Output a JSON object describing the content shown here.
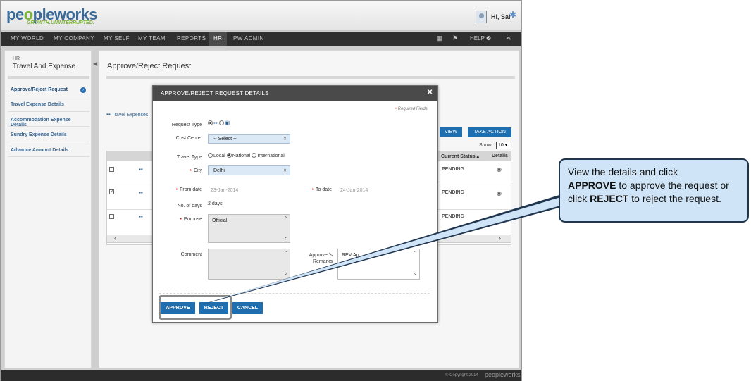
{
  "app": {
    "logo_pre": "pe",
    "logo_o": "o",
    "logo_post": "pleworks",
    "tagline": "GROWTH.UNINTERRUPTED.",
    "greeting": "Hi, Sai",
    "settings_icon": "gear-icon"
  },
  "nav": {
    "items": [
      "MY WORLD",
      "MY COMPANY",
      "MY SELF",
      "MY TEAM",
      "REPORTS",
      "HR",
      "PW ADMIN"
    ],
    "active": "HR",
    "help": "HELP ❷"
  },
  "sidebar": {
    "small": "HR",
    "title": "Travel And Expense",
    "items": [
      "Approve/Reject Request",
      "Travel Expense Details",
      "Accommodation Expense Details",
      "Sundry Expense Details",
      "Advance Amount Details"
    ]
  },
  "main": {
    "title": "Approve/Reject Request",
    "tab": "Travel Expenses",
    "view_btn": "VIEW",
    "take_action_btn": "TAKE ACTION",
    "show_label": "Show:",
    "show_value": "10",
    "col_status": "Current Status ▴",
    "col_details": "Details",
    "rows": [
      {
        "checked": false,
        "status": "PENDING"
      },
      {
        "checked": true,
        "status": "PENDING"
      },
      {
        "checked": false,
        "status": "PENDING"
      }
    ]
  },
  "modal": {
    "title": "APPROVE/REJECT REQUEST DETAILS",
    "required_note": "Required Fields",
    "request_type_label": "Request Type",
    "cost_center_label": "Cost Center",
    "cost_center_value": "-- Select --",
    "travel_type_label": "Travel Type",
    "travel_types": [
      "Local",
      "National",
      "International"
    ],
    "travel_type_selected": "National",
    "city_label": "City",
    "city_value": "Delhi",
    "from_date_label": "From date",
    "from_date_value": "23-Jan-2014",
    "to_date_label": "To date",
    "to_date_value": "24-Jan-2014",
    "days_label": "No. of days",
    "days_value": "2 days",
    "purpose_label": "Purpose",
    "purpose_value": "Official",
    "comment_label": "Comment",
    "approver_label_1": "Approver's",
    "approver_label_2": "Remarks",
    "approver_value": "REV Ap",
    "approve_btn": "APPROVE",
    "reject_btn": "REJECT",
    "cancel_btn": "CANCEL"
  },
  "footer": {
    "copyright": "© Copyright 2014",
    "logo": "peopleworks"
  },
  "callout": {
    "t1": "View the details and click",
    "t2": "APPROVE",
    "t3": " to approve the request or click ",
    "t4": "REJECT",
    "t5": " to reject the request."
  },
  "colors": {
    "accent": "#1f6fb0",
    "callout_bg": "#cfe4f6",
    "nav_bg": "#2f2f2f",
    "brand_green": "#7bb33a"
  }
}
